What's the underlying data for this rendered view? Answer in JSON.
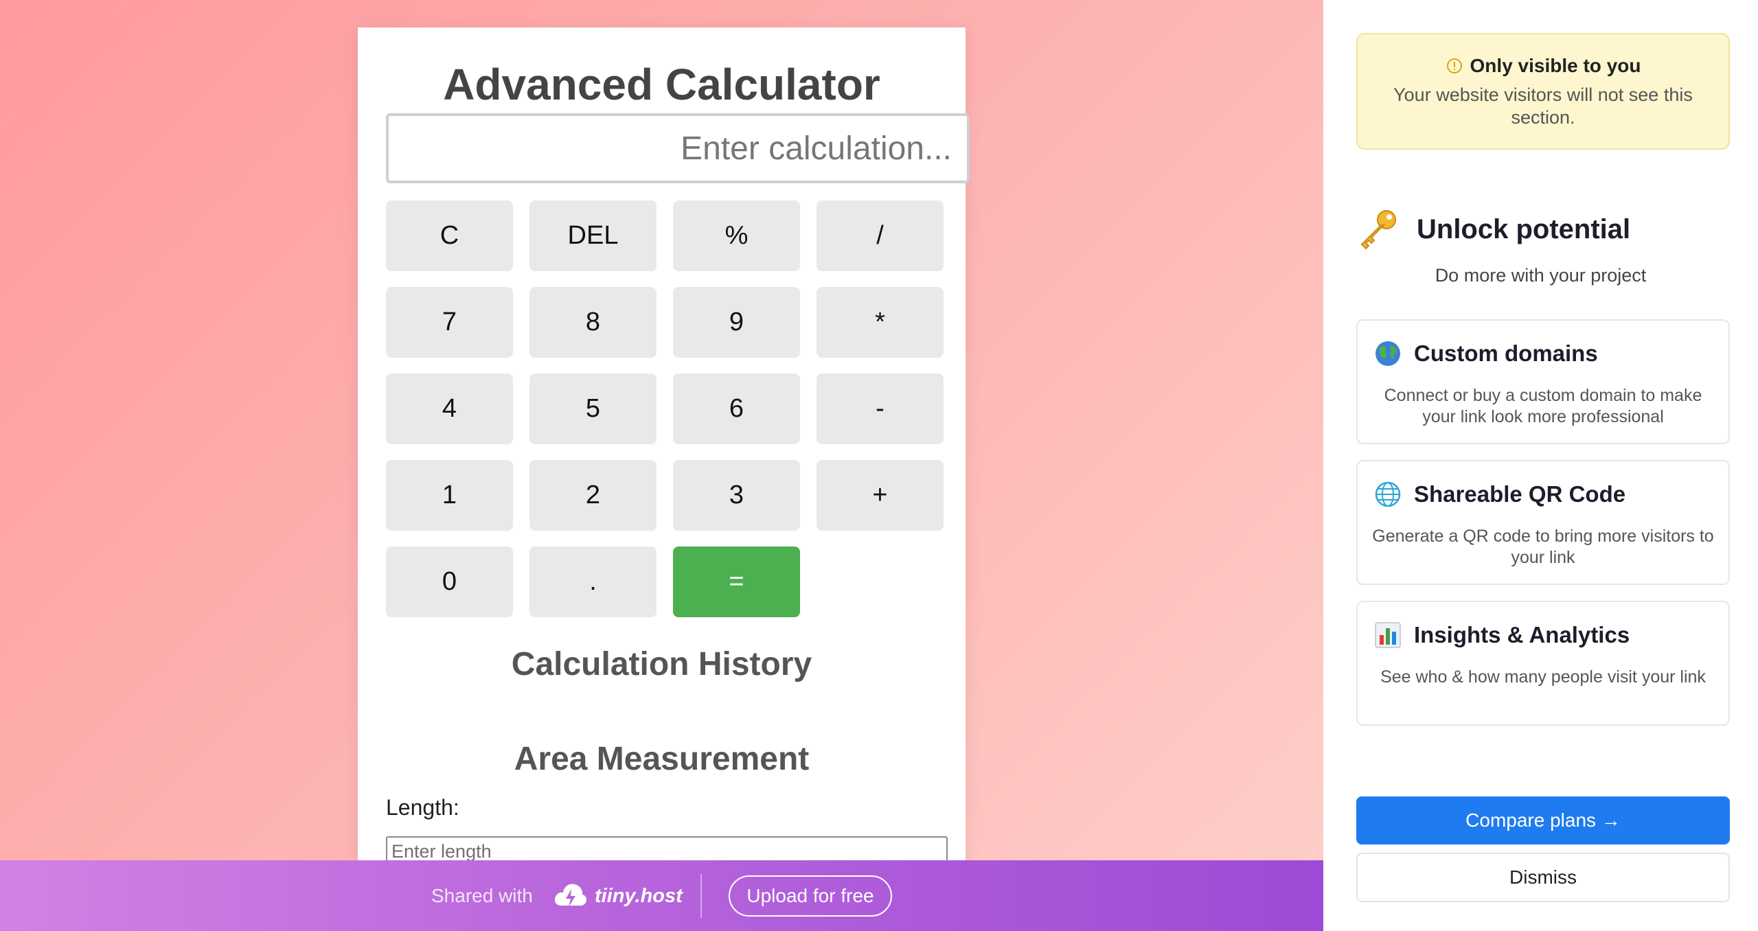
{
  "calculator": {
    "title": "Advanced Calculator",
    "display_placeholder": "Enter calculation...",
    "keys": [
      "C",
      "DEL",
      "%",
      "/",
      "7",
      "8",
      "9",
      "*",
      "4",
      "5",
      "6",
      "-",
      "1",
      "2",
      "3",
      "+",
      "0",
      ".",
      "="
    ],
    "equals_color": "#4caf50",
    "history_heading": "Calculation History",
    "area_heading": "Area Measurement",
    "length_label": "Length:",
    "length_placeholder": "Enter length"
  },
  "banner": {
    "shared_label": "Shared with",
    "brand": "tiiny.host",
    "brand_icon": "cloud-bolt-icon",
    "upload_label": "Upload for free"
  },
  "sidebar": {
    "notice": {
      "icon": "info-circle-icon",
      "title": "Only visible to you",
      "text": "Your website visitors will not see this section."
    },
    "unlock": {
      "icon": "key-icon",
      "title": "Unlock potential",
      "subtitle": "Do more with your project"
    },
    "features": [
      {
        "icon": "globe-earth-icon",
        "title": "Custom domains",
        "description": "Connect or buy a custom domain to make your link look more professional"
      },
      {
        "icon": "globe-grid-icon",
        "title": "Shareable QR Code",
        "description": "Generate a QR code to bring more visitors to your link"
      },
      {
        "icon": "bar-chart-icon",
        "title": "Insights & Analytics",
        "description": "See who & how many people visit your link"
      }
    ],
    "compare_label": "Compare plans →",
    "dismiss_label": "Dismiss",
    "accent_color": "#1f7bf0"
  }
}
